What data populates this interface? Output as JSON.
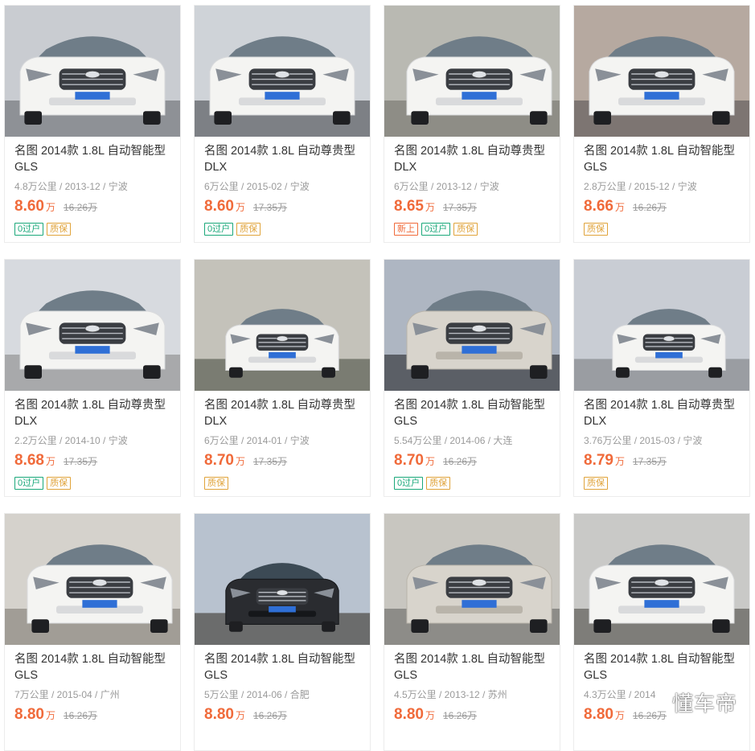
{
  "colors": {
    "price": "#f06a3a",
    "tag_transfer": "#1aa87a",
    "tag_warranty": "#e0a33a",
    "tag_new": "#f06a3a"
  },
  "watermark": "懂车帝",
  "listings": [
    {
      "title": "名图 2014款 1.8L 自动智能型 GLS",
      "meta": "4.8万公里 / 2013-12 / 宁波",
      "price": "8.60",
      "unit": "万",
      "original_price": "16.26万",
      "tags": [
        {
          "label": "0过户",
          "kind": "transfer"
        },
        {
          "label": "质保",
          "kind": "warranty"
        }
      ],
      "car_color": "white",
      "view": "front"
    },
    {
      "title": "名图 2014款 1.8L 自动尊贵型 DLX",
      "meta": "6万公里 / 2015-02 / 宁波",
      "price": "8.60",
      "unit": "万",
      "original_price": "17.35万",
      "tags": [
        {
          "label": "0过户",
          "kind": "transfer"
        },
        {
          "label": "质保",
          "kind": "warranty"
        }
      ],
      "car_color": "white",
      "view": "front"
    },
    {
      "title": "名图 2014款 1.8L 自动尊贵型 DLX",
      "meta": "6万公里 / 2013-12 / 宁波",
      "price": "8.65",
      "unit": "万",
      "original_price": "17.35万",
      "tags": [
        {
          "label": "新上",
          "kind": "new"
        },
        {
          "label": "0过户",
          "kind": "transfer"
        },
        {
          "label": "质保",
          "kind": "warranty"
        }
      ],
      "car_color": "white",
      "view": "angle"
    },
    {
      "title": "名图 2014款 1.8L 自动智能型 GLS",
      "meta": "2.8万公里 / 2015-12 / 宁波",
      "price": "8.66",
      "unit": "万",
      "original_price": "16.26万",
      "tags": [
        {
          "label": "质保",
          "kind": "warranty"
        }
      ],
      "car_color": "white",
      "view": "front"
    },
    {
      "title": "名图 2014款 1.8L 自动尊贵型 DLX",
      "meta": "2.2万公里 / 2014-10 / 宁波",
      "price": "8.68",
      "unit": "万",
      "original_price": "17.35万",
      "tags": [
        {
          "label": "0过户",
          "kind": "transfer"
        },
        {
          "label": "质保",
          "kind": "warranty"
        }
      ],
      "car_color": "white",
      "view": "front"
    },
    {
      "title": "名图 2014款 1.8L 自动尊贵型 DLX",
      "meta": "6万公里 / 2014-01 / 宁波",
      "price": "8.70",
      "unit": "万",
      "original_price": "17.35万",
      "tags": [
        {
          "label": "质保",
          "kind": "warranty"
        }
      ],
      "car_color": "white",
      "view": "front-far"
    },
    {
      "title": "名图 2014款 1.8L 自动智能型 GLS",
      "meta": "5.54万公里 / 2014-06 / 大连",
      "price": "8.70",
      "unit": "万",
      "original_price": "16.26万",
      "tags": [
        {
          "label": "0过户",
          "kind": "transfer"
        },
        {
          "label": "质保",
          "kind": "warranty"
        }
      ],
      "car_color": "silver",
      "view": "angle"
    },
    {
      "title": "名图 2014款 1.8L 自动尊贵型 DLX",
      "meta": "3.76万公里 / 2015-03 / 宁波",
      "price": "8.79",
      "unit": "万",
      "original_price": "17.35万",
      "tags": [
        {
          "label": "质保",
          "kind": "warranty"
        }
      ],
      "car_color": "white",
      "view": "angle-far"
    },
    {
      "title": "名图 2014款 1.8L 自动智能型 GLS",
      "meta": "7万公里 / 2015-04 / 广州",
      "price": "8.80",
      "unit": "万",
      "original_price": "16.26万",
      "tags": [],
      "car_color": "white",
      "view": "angle"
    },
    {
      "title": "名图 2014款 1.8L 自动智能型 GLS",
      "meta": "5万公里 / 2014-06 / 合肥",
      "price": "8.80",
      "unit": "万",
      "original_price": "16.26万",
      "tags": [],
      "car_color": "black",
      "view": "front-far"
    },
    {
      "title": "名图 2014款 1.8L 自动智能型 GLS",
      "meta": "4.5万公里 / 2013-12 / 苏州",
      "price": "8.80",
      "unit": "万",
      "original_price": "16.26万",
      "tags": [],
      "car_color": "silver",
      "view": "angle"
    },
    {
      "title": "名图 2014款 1.8L 自动智能型 GLS",
      "meta": "4.3万公里 / 2014",
      "price": "8.80",
      "unit": "万",
      "original_price": "16.26万",
      "tags": [],
      "car_color": "white",
      "view": "front"
    }
  ]
}
